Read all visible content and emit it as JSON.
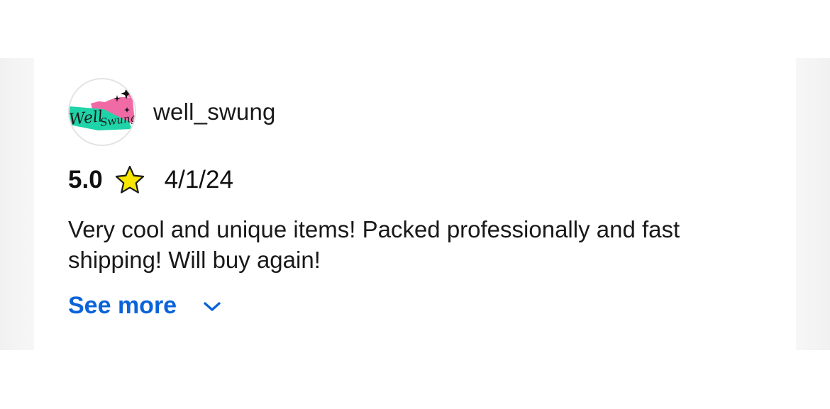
{
  "review": {
    "username": "well_swung",
    "avatar_logo_text": "Well Swung",
    "rating": "5.0",
    "star_icon": "star-icon",
    "date": "4/1/24",
    "text": "Very cool and unique items! Packed professionally and fast shipping! Will buy again!",
    "see_more_label": "See more",
    "expand_icon": "chevron-down-icon"
  },
  "colors": {
    "link": "#0b63d9",
    "star_fill": "#f7e600",
    "text": "#191919",
    "avatar_pink": "#f06aa6",
    "avatar_teal": "#1fd4a8"
  }
}
